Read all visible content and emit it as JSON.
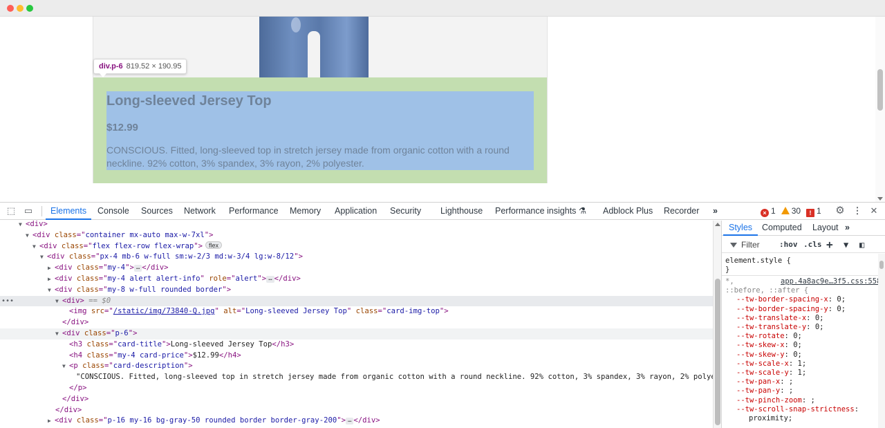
{
  "page": {
    "tooltip": {
      "tag": "div.p-6",
      "dims": "819.52 × 190.95"
    },
    "card": {
      "title": "Long-sleeved Jersey Top",
      "price": "$12.99",
      "description": "CONSCIOUS. Fitted, long-sleeved top in stretch jersey made from organic cotton with a round neckline. 92% cotton, 3% spandex, 3% rayon, 2% polyester."
    }
  },
  "devtools": {
    "tabs": [
      "Elements",
      "Console",
      "Sources",
      "Network",
      "Performance",
      "Memory",
      "Application",
      "Security",
      "Lighthouse",
      "Performance insights",
      "Adblock Plus",
      "Recorder"
    ],
    "active_tab": "Elements",
    "more_tabs": "»",
    "counts": {
      "errors": "1",
      "warnings": "30",
      "issues": "1"
    }
  },
  "dom": {
    "div": "div",
    "container_class": "container mx-auto max-w-7xl",
    "flex_class": "flex flex-row flex-wrap",
    "flex_badge": "flex",
    "col_class": "px-4 mb-6 w-full sm:w-2/3 md:w-3/4 lg:w-8/12",
    "my4_class": "my-4",
    "alert_class": "my-4 alert alert-info",
    "alert_role": "alert",
    "card_class": "my-8 w-full rounded border",
    "selected_marker": "== $0",
    "img_src": "/static/img/73840-Q.jpg",
    "img_alt": "Long-sleeved Jersey Top",
    "img_class": "card-img-top",
    "p6_class": "p-6",
    "h3_class": "card-title",
    "h3_text": "Long-sleeved Jersey Top",
    "h4_class": "my-4 card-price",
    "h4_text": "$12.99",
    "p_class": "card-description",
    "p_text": "\"CONSCIOUS. Fitted, long-sleeved top in stretch jersey made from organic cotton with a round neckline. 92% cotton, 3% spandex, 3% rayon, 2% polyester.\"",
    "last_class": "p-16 my-16 bg-gray-50 rounded border border-gray-200"
  },
  "styles": {
    "tabs": [
      "Styles",
      "Computed",
      "Layout"
    ],
    "active_tab": "Styles",
    "more": "»",
    "filter_placeholder": "Filter",
    "hov": ":hov",
    "cls": ".cls",
    "element_style": "element.style {",
    "close_brace": "}",
    "rule_selector": "*,",
    "rule_selector2": "::before, ::after {",
    "rule_file": "app.4a8ac9e…3f5.css:558",
    "declarations": [
      {
        "prop": "--tw-border-spacing-x",
        "value": "0;"
      },
      {
        "prop": "--tw-border-spacing-y",
        "value": "0;"
      },
      {
        "prop": "--tw-translate-x",
        "value": "0;"
      },
      {
        "prop": "--tw-translate-y",
        "value": "0;"
      },
      {
        "prop": "--tw-rotate",
        "value": "0;"
      },
      {
        "prop": "--tw-skew-x",
        "value": "0;"
      },
      {
        "prop": "--tw-skew-y",
        "value": "0;"
      },
      {
        "prop": "--tw-scale-x",
        "value": "1;"
      },
      {
        "prop": "--tw-scale-y",
        "value": "1;"
      },
      {
        "prop": "--tw-pan-x",
        "value": ";"
      },
      {
        "prop": "--tw-pan-y",
        "value": ";"
      },
      {
        "prop": "--tw-pinch-zoom",
        "value": ";"
      },
      {
        "prop": "--tw-scroll-snap-strictness",
        "value": ""
      }
    ],
    "wrapped_value": "proximity;"
  }
}
